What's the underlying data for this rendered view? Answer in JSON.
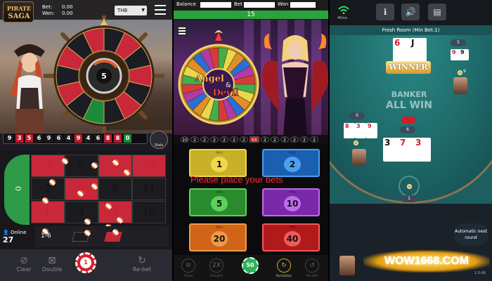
{
  "roulette": {
    "logo_line1": "PIRATE",
    "logo_line2": "SAGA",
    "bet_label": "Bet:",
    "bet_value": "0.00",
    "won_label": "Won:",
    "won_value": "0.00",
    "currency": "THB",
    "wheel_result": "5",
    "history": [
      {
        "n": "9",
        "c": "blk"
      },
      {
        "n": "3",
        "c": "red"
      },
      {
        "n": "5",
        "c": "red"
      },
      {
        "n": "6",
        "c": "blk"
      },
      {
        "n": "9",
        "c": "blk"
      },
      {
        "n": "6",
        "c": "blk"
      },
      {
        "n": "4",
        "c": "blk"
      },
      {
        "n": "9",
        "c": "red"
      },
      {
        "n": "4",
        "c": "blk"
      },
      {
        "n": "6",
        "c": "blk"
      },
      {
        "n": "8",
        "c": "red"
      },
      {
        "n": "8",
        "c": "red"
      },
      {
        "n": "0",
        "c": "grn"
      }
    ],
    "stats_label": "Stats",
    "zero_label": "0",
    "cells": [
      {
        "n": "3",
        "c": "red"
      },
      {
        "n": "6",
        "c": "blk"
      },
      {
        "n": "9",
        "c": "red"
      },
      {
        "n": "12",
        "c": "red"
      },
      {
        "n": "2",
        "c": "blk"
      },
      {
        "n": "5",
        "c": "red"
      },
      {
        "n": "8",
        "c": "blk"
      },
      {
        "n": "11",
        "c": "blk"
      },
      {
        "n": "1",
        "c": "red"
      },
      {
        "n": "4",
        "c": "blk"
      },
      {
        "n": "7",
        "c": "red"
      },
      {
        "n": "10",
        "c": "blk"
      }
    ],
    "range_label": "1-6",
    "online_label": "Online",
    "online_count": "27",
    "btn_clear": "Clear",
    "btn_double": "Double",
    "chip_value": "1",
    "btn_rebet": "Re-bet"
  },
  "angel": {
    "balance_label": "Balance",
    "bet_label": "Bet",
    "won_label": "Won",
    "timer": "15",
    "title1": "Angel",
    "title2": "Devil",
    "amp": "&",
    "stats": [
      "10",
      "2",
      "2",
      "2",
      "2",
      "2",
      "2",
      "6X",
      "2",
      "2",
      "2",
      "2",
      "2",
      "2"
    ],
    "bills": [
      {
        "num": "1",
        "pays": "PAYS"
      },
      {
        "num": "2",
        "pays": "PAYS"
      },
      {
        "num": "5",
        "pays": "PAYS"
      },
      {
        "num": "10",
        "pays": "PAYS"
      },
      {
        "num": "20",
        "pays": "PAYS"
      },
      {
        "num": "40",
        "pays": "PAYS"
      }
    ],
    "message": "Please place your bets",
    "btn_clear": "Clear",
    "btn_double": "Double",
    "btn_double_glyph": "2X",
    "chip_value": "50",
    "btn_autoplay": "Autoplay",
    "btn_rebet": "Re-bet"
  },
  "baccarat": {
    "ping": "40ms",
    "room": "Fresh Room (Min Bet:1)",
    "winner": "WINNER",
    "banker_ghost": "BANKER",
    "allwin_ghost": "ALL WIN",
    "banker_score": "5",
    "player_score": "0",
    "main_score": "6",
    "sub_score": "9",
    "bet_count": "1",
    "auto_next": "Automatic next round",
    "brand": "WOW1668.COM",
    "version": "1.0.48"
  }
}
